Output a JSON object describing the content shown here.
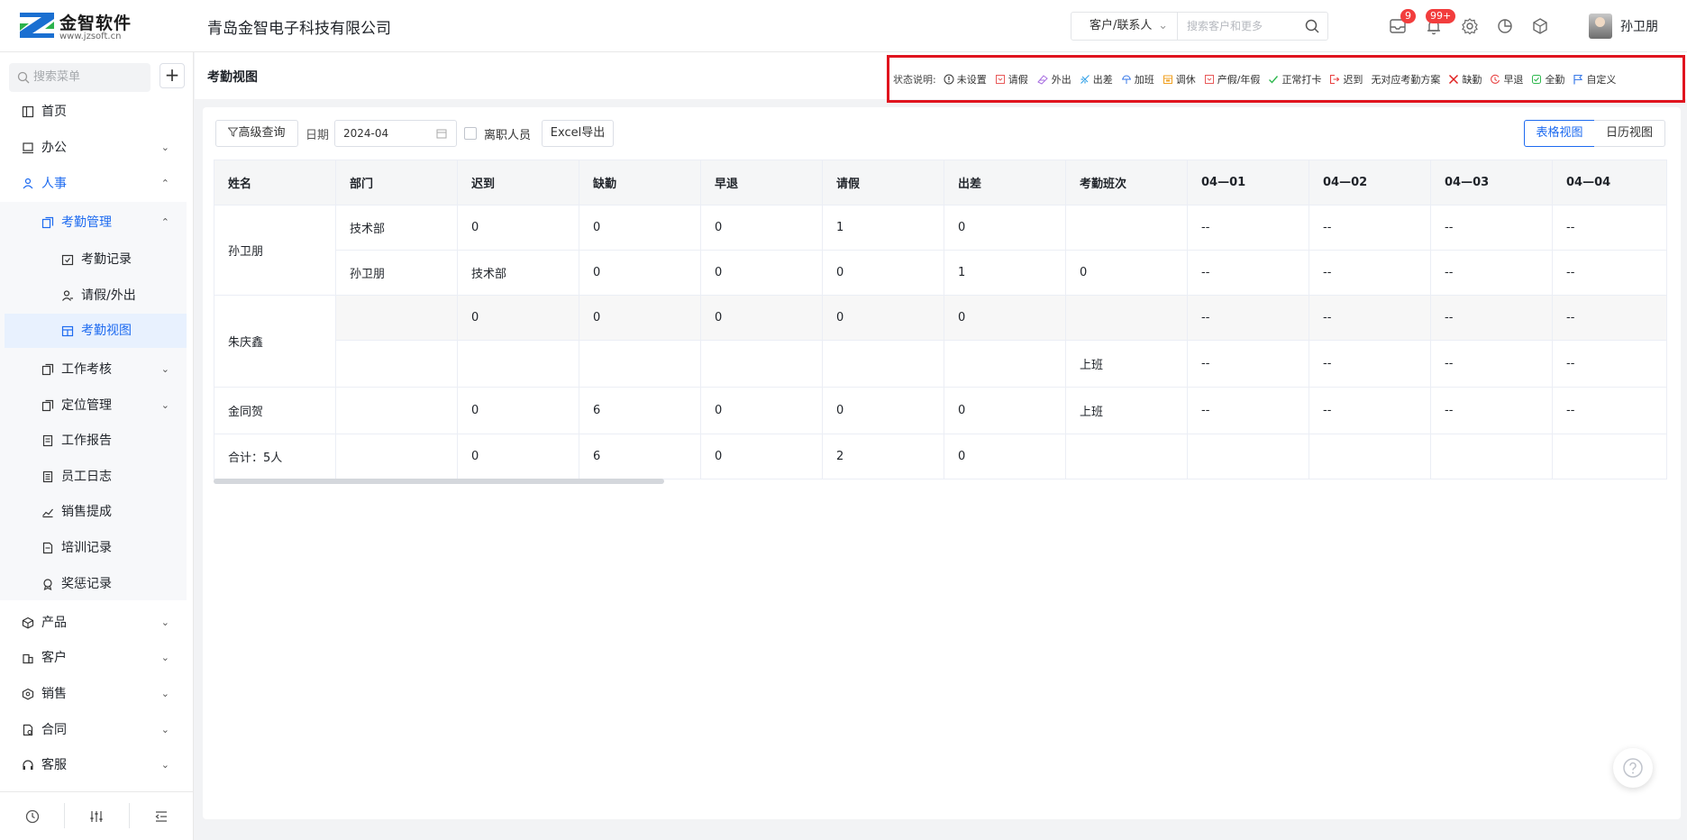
{
  "header": {
    "logo_title": "金智软件",
    "logo_sub": "www.jzsoft.cn",
    "company": "青岛金智电子科技有限公司",
    "search_type": "客户/联系人",
    "search_placeholder": "搜索客户和更多",
    "badge_tasks": "9",
    "badge_notifications": "99+",
    "username": "孙卫朋"
  },
  "sidebar": {
    "search_placeholder": "搜索菜单",
    "add_label": "+",
    "items": [
      {
        "label": "首页",
        "icon": "home-icon"
      },
      {
        "label": "办公",
        "icon": "office-icon"
      },
      {
        "label": "人事",
        "icon": "hr-icon"
      },
      {
        "label": "考勤管理",
        "icon": "attendance-icon"
      },
      {
        "label": "考勤记录",
        "icon": "calendar-check-icon"
      },
      {
        "label": "请假/外出",
        "icon": "user-leave-icon"
      },
      {
        "label": "考勤视图",
        "icon": "calendar-grid-icon"
      },
      {
        "label": "工作考核",
        "icon": "copy-icon"
      },
      {
        "label": "定位管理",
        "icon": "copy-icon"
      },
      {
        "label": "工作报告",
        "icon": "report-icon"
      },
      {
        "label": "员工日志",
        "icon": "log-icon"
      },
      {
        "label": "销售提成",
        "icon": "chart-icon"
      },
      {
        "label": "培训记录",
        "icon": "document-icon"
      },
      {
        "label": "奖惩记录",
        "icon": "medal-icon"
      },
      {
        "label": "产品",
        "icon": "cube-icon"
      },
      {
        "label": "客户",
        "icon": "building-icon"
      },
      {
        "label": "销售",
        "icon": "hexagon-icon"
      },
      {
        "label": "合同",
        "icon": "contract-icon"
      },
      {
        "label": "客服",
        "icon": "headset-icon"
      }
    ]
  },
  "page": {
    "title": "考勤视图",
    "legend_label": "状态说明:",
    "legend": [
      {
        "label": "未设置",
        "icon": "info-circle-icon",
        "color": "#333333"
      },
      {
        "label": "请假",
        "icon": "leave-icon",
        "color": "#e85a5a"
      },
      {
        "label": "外出",
        "icon": "outing-icon",
        "color": "#a66be0"
      },
      {
        "label": "出差",
        "icon": "plane-icon",
        "color": "#3aa5e8"
      },
      {
        "label": "加班",
        "icon": "overtime-icon",
        "color": "#3a7ae8"
      },
      {
        "label": "调休",
        "icon": "rest-icon",
        "color": "#f0a020"
      },
      {
        "label": "产假/年假",
        "icon": "maternity-icon",
        "color": "#e85a5a"
      },
      {
        "label": "正常打卡",
        "icon": "check-icon",
        "color": "#2fb84f"
      },
      {
        "label": "迟到",
        "icon": "late-icon",
        "color": "#e84040"
      },
      {
        "label": "无对应考勤方案",
        "icon": "",
        "color": "#333333"
      },
      {
        "label": "缺勤",
        "icon": "cross-icon",
        "color": "#e02020"
      },
      {
        "label": "早退",
        "icon": "early-leave-icon",
        "color": "#e84040"
      },
      {
        "label": "全勤",
        "icon": "full-attendance-icon",
        "color": "#2fb84f"
      },
      {
        "label": "自定义",
        "icon": "flag-icon",
        "color": "#3a7ae8"
      }
    ]
  },
  "toolbar": {
    "advanced_query": "高级查询",
    "date_label": "日期",
    "date_value": "2024-04",
    "resigned_label": "离职人员",
    "excel_export": "Excel导出",
    "table_view": "表格视图",
    "calendar_view": "日历视图"
  },
  "table": {
    "headers": [
      "姓名",
      "部门",
      "迟到",
      "缺勤",
      "早退",
      "请假",
      "出差",
      "考勤班次",
      "04—01",
      "04—02",
      "04—03",
      "04—04"
    ],
    "rows": [
      [
        "孙卫朋",
        "技术部",
        "0",
        "0",
        "0",
        "1",
        "0",
        "",
        "--",
        "--",
        "--",
        "--"
      ],
      [
        "孙卫朋",
        "技术部",
        "0",
        "0",
        "0",
        "1",
        "0",
        "--",
        "--",
        "--",
        "--"
      ],
      [
        "朱庆鑫",
        "",
        "0",
        "0",
        "0",
        "0",
        "0",
        "",
        "--",
        "--",
        "--",
        "--"
      ],
      [
        "",
        "",
        "",
        "",
        "",
        "",
        "上班",
        "--",
        "--",
        "--",
        "--"
      ],
      [
        "金同贺",
        "",
        "0",
        "6",
        "0",
        "0",
        "0",
        "上班",
        "--",
        "--",
        "--",
        "--"
      ],
      [
        "合计：5人",
        "",
        "0",
        "6",
        "0",
        "2",
        "0",
        "",
        "",
        "",
        "",
        ""
      ]
    ]
  }
}
